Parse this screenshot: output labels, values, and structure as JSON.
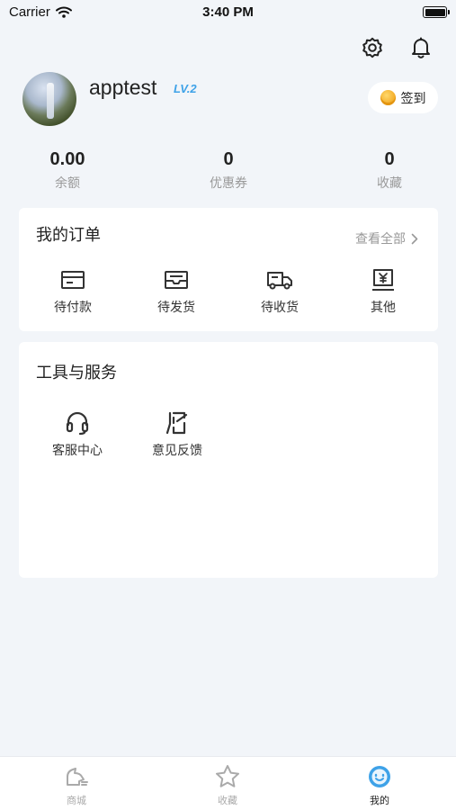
{
  "status_bar": {
    "carrier": "Carrier",
    "time": "3:40 PM"
  },
  "header": {
    "settings_icon": "gear-icon",
    "notification_icon": "bell-icon"
  },
  "profile": {
    "username": "apptest",
    "level": "LV.2",
    "signin_label": "签到"
  },
  "stats": [
    {
      "value": "0.00",
      "label": "余额"
    },
    {
      "value": "0",
      "label": "优惠券"
    },
    {
      "value": "0",
      "label": "收藏"
    }
  ],
  "orders": {
    "title": "我的订单",
    "view_all": "查看全部",
    "items": [
      {
        "label": "待付款",
        "icon": "card-icon"
      },
      {
        "label": "待发货",
        "icon": "box-icon"
      },
      {
        "label": "待收货",
        "icon": "truck-icon"
      },
      {
        "label": "其他",
        "icon": "receipt-icon"
      }
    ]
  },
  "services": {
    "title": "工具与服务",
    "items": [
      {
        "label": "客服中心",
        "icon": "headset-icon"
      },
      {
        "label": "意见反馈",
        "icon": "feedback-icon"
      }
    ]
  },
  "tabbar": {
    "items": [
      {
        "label": "商城",
        "icon": "shop-icon",
        "active": false
      },
      {
        "label": "收藏",
        "icon": "star-icon",
        "active": false
      },
      {
        "label": "我的",
        "icon": "face-icon",
        "active": true
      }
    ]
  },
  "colors": {
    "accent": "#3ea2e8",
    "background": "#f2f5f9"
  }
}
